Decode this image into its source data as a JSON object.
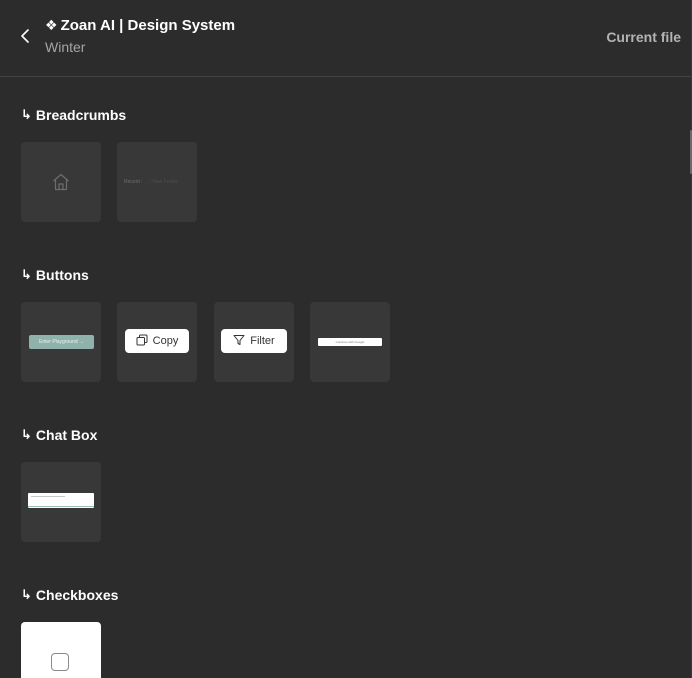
{
  "header": {
    "component_glyph": "❖",
    "title": "Zoan AI | Design System",
    "subtitle": "Winter",
    "current_file": "Current file",
    "back_icon": "chevron-left-icon"
  },
  "sections": {
    "breadcrumbs": {
      "arrow": "↳",
      "title": "Breadcrumbs",
      "crumb_preview": {
        "first": "Recent",
        "separator": "/  ...  /",
        "last": "New Folder"
      }
    },
    "buttons": {
      "arrow": "↳",
      "title": "Buttons",
      "teal_button_label": "Enter Playground  →",
      "copy_label": "Copy",
      "filter_label": "Filter",
      "long_button_label": "Continue with Google"
    },
    "chat_box": {
      "arrow": "↳",
      "title": "Chat Box"
    },
    "checkboxes": {
      "arrow": "↳",
      "title": "Checkboxes"
    }
  },
  "colors": {
    "background": "#2c2c2c",
    "tile": "#383838",
    "accent_teal": "#8fb3aa",
    "muted_text": "#a5a5a5"
  }
}
